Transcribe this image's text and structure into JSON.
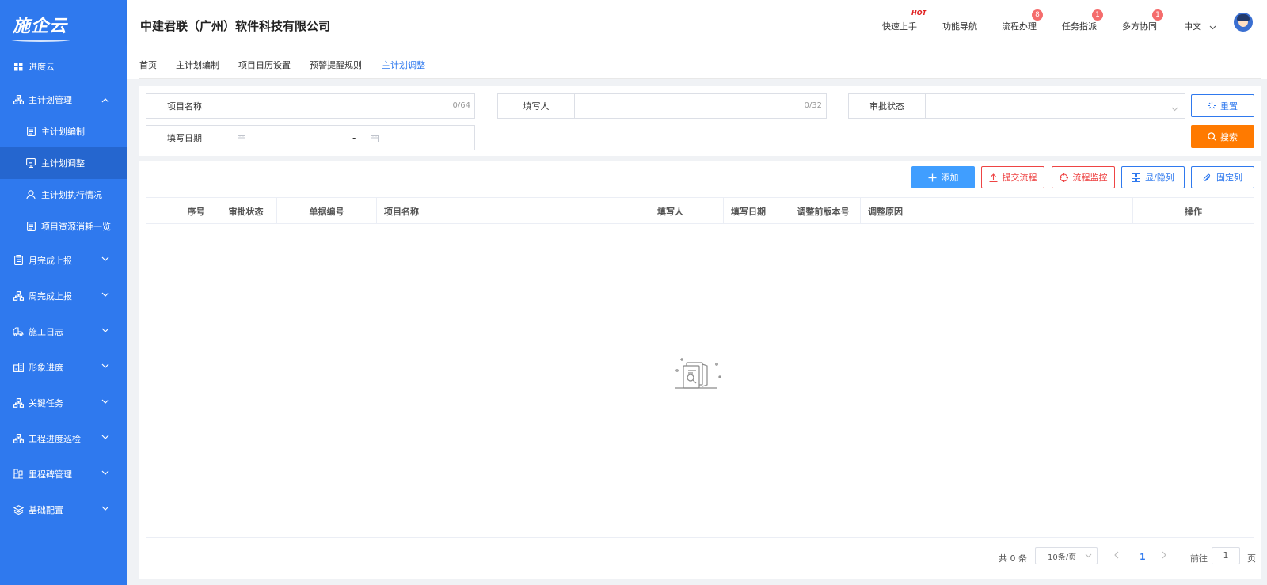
{
  "logo": "施企云",
  "sidebar": {
    "top": {
      "label": "进度云",
      "icon": "grid-icon"
    },
    "groups": [
      {
        "label": "主计划管理",
        "icon": "sitemap-icon",
        "expanded": true,
        "items": [
          {
            "label": "主计划编制",
            "icon": "doc-icon",
            "active": false
          },
          {
            "label": "主计划调整",
            "icon": "adjust-icon",
            "active": true
          },
          {
            "label": "主计划执行情况",
            "icon": "user-icon",
            "active": false
          },
          {
            "label": "项目资源消耗一览",
            "icon": "doc-icon",
            "active": false
          }
        ]
      },
      {
        "label": "月完成上报",
        "icon": "clipboard-icon"
      },
      {
        "label": "周完成上报",
        "icon": "sitemap-icon"
      },
      {
        "label": "施工日志",
        "icon": "truck-icon"
      },
      {
        "label": "形象进度",
        "icon": "coins-icon"
      },
      {
        "label": "关键任务",
        "icon": "sitemap-icon"
      },
      {
        "label": "工程进度巡检",
        "icon": "sitemap-icon"
      },
      {
        "label": "里程碑管理",
        "icon": "milestone-icon"
      },
      {
        "label": "基础配置",
        "icon": "layers-icon"
      }
    ]
  },
  "header": {
    "company": "中建君联（广州）软件科技有限公司",
    "links": [
      {
        "label": "快速上手",
        "badge": "",
        "hot": "HOT"
      },
      {
        "label": "功能导航",
        "badge": "",
        "hot": ""
      },
      {
        "label": "流程办理",
        "badge": "8",
        "hot": ""
      },
      {
        "label": "任务指派",
        "badge": "1",
        "hot": ""
      },
      {
        "label": "多方协同",
        "badge": "1",
        "hot": ""
      }
    ],
    "lang": "中文"
  },
  "tabs": [
    {
      "label": "首页",
      "active": false
    },
    {
      "label": "主计划编制",
      "active": false
    },
    {
      "label": "项目日历设置",
      "active": false
    },
    {
      "label": "预警提醒规则",
      "active": false
    },
    {
      "label": "主计划调整",
      "active": true
    }
  ],
  "filter": {
    "project_name": {
      "label": "项目名称",
      "count": "0/64"
    },
    "writer": {
      "label": "填写人",
      "count": "0/32"
    },
    "status": {
      "label": "审批状态"
    },
    "date": {
      "label": "填写日期",
      "sep": "-"
    },
    "reset": "重置",
    "search": "搜索"
  },
  "toolbar": {
    "add": "添加",
    "submit": "提交流程",
    "monitor": "流程监控",
    "toggle_cols": "显/隐列",
    "fix_cols": "固定列"
  },
  "table": {
    "columns": [
      "序号",
      "审批状态",
      "单据编号",
      "项目名称",
      "填写人",
      "填写日期",
      "调整前版本号",
      "调整原因",
      "操作"
    ],
    "rows": []
  },
  "pager": {
    "total": "共 0 条",
    "size": "10条/页",
    "current": "1",
    "goto": "前往",
    "goto_value": "1",
    "page_suffix": "页"
  },
  "colors": {
    "sidebar": "#2f79ee",
    "accent": "#2f79ee",
    "orange": "#ff7a00",
    "red": "#ee4444",
    "badge": "#f56c6c"
  }
}
